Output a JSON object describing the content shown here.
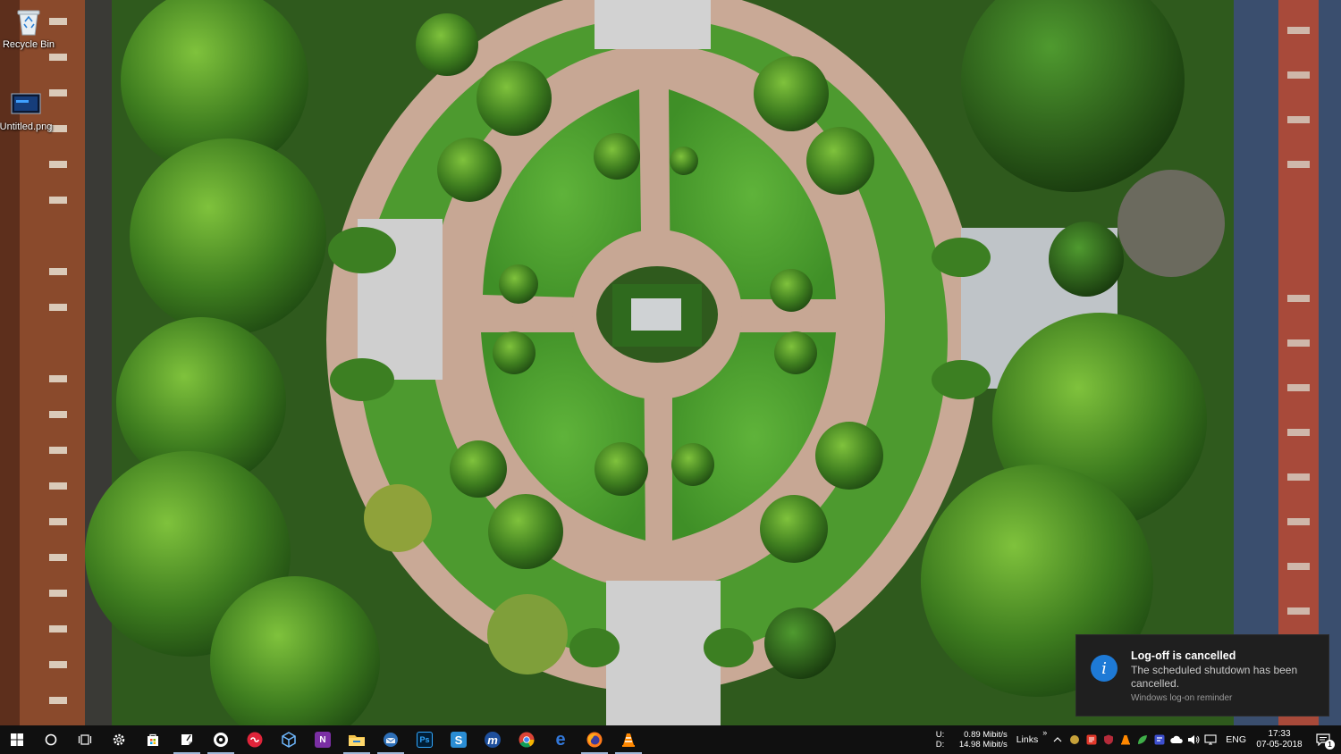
{
  "desktop": {
    "icons": [
      {
        "label": "Recycle Bin",
        "icon": "recycle-bin-icon"
      },
      {
        "label": "Untitled.png",
        "icon": "image-file-icon"
      }
    ]
  },
  "toast": {
    "title": "Log-off is cancelled",
    "body": "The scheduled shutdown has been cancelled.",
    "source": "Windows log-on reminder",
    "icon": "info-icon",
    "accent": "#1e7ad6"
  },
  "taskbar": {
    "apps": [
      {
        "name": "start",
        "icon": "windows-logo-icon"
      },
      {
        "name": "cortana",
        "icon": "search-circle-icon"
      },
      {
        "name": "task-view",
        "icon": "task-view-icon"
      },
      {
        "name": "settings",
        "icon": "gear-icon"
      },
      {
        "name": "store",
        "icon": "store-bag-icon"
      },
      {
        "name": "sticky-notes",
        "icon": "sticky-notes-icon"
      },
      {
        "name": "groove",
        "icon": "disc-icon"
      },
      {
        "name": "app-red",
        "icon": "red-circle-app-icon"
      },
      {
        "name": "3d-builder",
        "icon": "cube-icon"
      },
      {
        "name": "onenote",
        "icon": "onenote-icon",
        "letter": "N"
      },
      {
        "name": "file-explorer",
        "icon": "folder-icon"
      },
      {
        "name": "thunderbird",
        "icon": "mail-bird-icon"
      },
      {
        "name": "photoshop",
        "icon": "photoshop-icon",
        "letter": "Ps"
      },
      {
        "name": "sway",
        "icon": "sway-icon",
        "letter": "S"
      },
      {
        "name": "maxthon",
        "icon": "maxthon-icon",
        "letter": "m"
      },
      {
        "name": "chrome",
        "icon": "chrome-icon"
      },
      {
        "name": "edge",
        "icon": "edge-icon",
        "letter": "e"
      },
      {
        "name": "firefox",
        "icon": "firefox-icon"
      },
      {
        "name": "vlc",
        "icon": "vlc-cone-icon"
      }
    ],
    "netspeed": {
      "up_label": "U:",
      "up_value": "0.89 Mibit/s",
      "down_label": "D:",
      "down_value": "14.98 Mibit/s"
    },
    "links_label": "Links",
    "links_chevron": "»",
    "tray_chevron": "^",
    "language": "ENG",
    "clock": {
      "time": "17:33",
      "date": "07-05-2018"
    },
    "notification_count": "1"
  }
}
